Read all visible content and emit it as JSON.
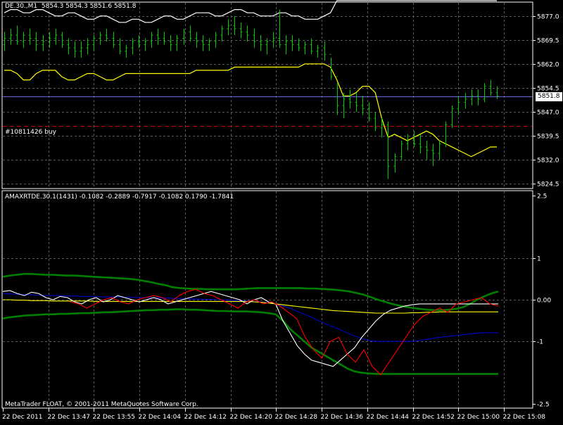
{
  "app": {
    "symbol_header": "DE.30.,M1",
    "ohlc_header": "5854.3 5854.3 5851.6 5851.8",
    "current_price_label": "5851.8",
    "order_label": "#10811426 buy",
    "indicator_header": "AMAXRTDE.30.1(1431) -0.1082 -0.2889 -0.7917 -0.1082 0.1790 -1.7841",
    "copyright": "MetaTrader FLOAT, © 2001-2011 MetaQuotes Software Corp.",
    "colors": {
      "background": "#000000",
      "grid": "#5a5a5a",
      "axis": "#ffffff",
      "bar": "#00cc00",
      "white_band": "#ffffff",
      "yellow_line": "#ffff00",
      "price_line": "#6b6bd6",
      "order_line": "#cc0000",
      "indicator_green": "#008000",
      "indicator_blue": "#0000cc",
      "indicator_red": "#ff0000",
      "indicator_white": "#ffffff",
      "indicator_yellow": "#ffff00"
    }
  },
  "chart_data": [
    {
      "type": "line",
      "panel": "price",
      "ylim": [
        5823,
        5882
      ],
      "yticks": [
        "5877.0",
        "5869.5",
        "5862.0",
        "5854.5",
        "5847.0",
        "5839.5",
        "5832.0",
        "5824.5"
      ],
      "x_labels": [
        "22 Dec 2011",
        "22 Dec 13:47",
        "22 Dec 13:55",
        "22 Dec 14:04",
        "22 Dec 14:12",
        "22 Dec 14:20",
        "22 Dec 14:28",
        "22 Dec 14:36",
        "22 Dec 14:44",
        "22 Dec 14:52",
        "22 Dec 15:00",
        "22 Dec 15:08"
      ],
      "current_price": 5851.8,
      "order_price": 5842.6,
      "bars": [
        [
          5868,
          5872,
          5866,
          5870
        ],
        [
          5870,
          5873,
          5868,
          5871
        ],
        [
          5871,
          5874,
          5868,
          5869
        ],
        [
          5869,
          5872,
          5867,
          5871
        ],
        [
          5871,
          5873,
          5868,
          5870
        ],
        [
          5870,
          5872,
          5866,
          5868
        ],
        [
          5868,
          5871,
          5866,
          5869
        ],
        [
          5869,
          5872,
          5867,
          5870
        ],
        [
          5870,
          5873,
          5868,
          5871
        ],
        [
          5871,
          5872,
          5867,
          5868
        ],
        [
          5868,
          5870,
          5865,
          5867
        ],
        [
          5867,
          5869,
          5864,
          5866
        ],
        [
          5866,
          5869,
          5864,
          5867
        ],
        [
          5867,
          5870,
          5865,
          5868
        ],
        [
          5868,
          5871,
          5866,
          5870
        ],
        [
          5870,
          5872,
          5868,
          5871
        ],
        [
          5871,
          5873,
          5869,
          5870
        ],
        [
          5870,
          5872,
          5867,
          5868
        ],
        [
          5868,
          5870,
          5865,
          5866
        ],
        [
          5866,
          5868,
          5864,
          5867
        ],
        [
          5867,
          5870,
          5865,
          5869
        ],
        [
          5869,
          5871,
          5867,
          5868
        ],
        [
          5868,
          5870,
          5866,
          5869
        ],
        [
          5869,
          5872,
          5867,
          5871
        ],
        [
          5871,
          5873,
          5868,
          5870
        ],
        [
          5870,
          5872,
          5868,
          5869
        ],
        [
          5869,
          5871,
          5866,
          5868
        ],
        [
          5868,
          5871,
          5866,
          5870
        ],
        [
          5870,
          5873,
          5868,
          5872
        ],
        [
          5872,
          5874,
          5869,
          5870
        ],
        [
          5870,
          5872,
          5867,
          5869
        ],
        [
          5869,
          5871,
          5866,
          5868
        ],
        [
          5868,
          5870,
          5866,
          5869
        ],
        [
          5869,
          5872,
          5867,
          5871
        ],
        [
          5871,
          5874,
          5869,
          5873
        ],
        [
          5873,
          5876,
          5871,
          5874
        ],
        [
          5874,
          5877,
          5871,
          5873
        ],
        [
          5873,
          5875,
          5870,
          5872
        ],
        [
          5872,
          5874,
          5869,
          5871
        ],
        [
          5871,
          5873,
          5867,
          5869
        ],
        [
          5869,
          5871,
          5866,
          5868
        ],
        [
          5868,
          5870,
          5865,
          5869
        ],
        [
          5869,
          5872,
          5867,
          5870
        ],
        [
          5870,
          5879,
          5867,
          5868
        ],
        [
          5868,
          5871,
          5865,
          5869
        ],
        [
          5869,
          5871,
          5866,
          5868
        ],
        [
          5868,
          5870,
          5866,
          5867
        ],
        [
          5867,
          5869,
          5865,
          5868
        ],
        [
          5868,
          5870,
          5865,
          5866
        ],
        [
          5866,
          5868,
          5864,
          5867
        ],
        [
          5867,
          5869,
          5863,
          5865
        ],
        [
          5865,
          5864,
          5857,
          5858
        ],
        [
          5858,
          5856,
          5846,
          5849
        ],
        [
          5849,
          5853,
          5845,
          5851
        ],
        [
          5851,
          5854,
          5848,
          5850
        ],
        [
          5850,
          5853,
          5847,
          5849
        ],
        [
          5849,
          5852,
          5846,
          5848
        ],
        [
          5848,
          5850,
          5844,
          5845
        ],
        [
          5845,
          5847,
          5841,
          5842
        ],
        [
          5842,
          5845,
          5839,
          5843
        ],
        [
          5843,
          5844,
          5826,
          5830
        ],
        [
          5830,
          5834,
          5828,
          5833
        ],
        [
          5833,
          5838,
          5832,
          5837
        ],
        [
          5837,
          5840,
          5835,
          5838
        ],
        [
          5838,
          5841,
          5836,
          5837
        ],
        [
          5837,
          5840,
          5834,
          5836
        ],
        [
          5836,
          5838,
          5832,
          5835
        ],
        [
          5835,
          5837,
          5830,
          5834
        ],
        [
          5834,
          5838,
          5832,
          5837
        ],
        [
          5837,
          5844,
          5836,
          5843
        ],
        [
          5843,
          5849,
          5842,
          5848
        ],
        [
          5848,
          5852,
          5846,
          5850
        ],
        [
          5850,
          5853,
          5848,
          5851
        ],
        [
          5851,
          5854,
          5849,
          5852
        ],
        [
          5852,
          5854,
          5849,
          5851
        ],
        [
          5851,
          5856,
          5850,
          5855
        ],
        [
          5855,
          5857,
          5852,
          5853
        ],
        [
          5853,
          5855,
          5851,
          5852
        ]
      ],
      "series": [
        {
          "color": "#ffffff",
          "values": [
            5878,
            5879,
            5879,
            5878,
            5878,
            5879,
            5879,
            5878,
            5877,
            5877,
            5878,
            5878,
            5877,
            5876,
            5876,
            5877,
            5877,
            5876,
            5875,
            5875,
            5876,
            5876,
            5875,
            5875,
            5876,
            5877,
            5877,
            5876,
            5876,
            5877,
            5878,
            5878,
            5878,
            5877,
            5877,
            5878,
            5879,
            5879,
            5878,
            5878,
            5877,
            5877,
            5877,
            5878,
            5878,
            5877,
            5877,
            5876,
            5876,
            5876,
            5877,
            5878,
            5882,
            5883,
            5884,
            5885,
            5885,
            5885,
            5885,
            5885,
            5885,
            5885,
            5885,
            5885,
            5885,
            5885,
            5885,
            5885,
            5885,
            5885,
            5885,
            5885,
            5885,
            5885,
            5885,
            5885,
            5885,
            5885
          ]
        },
        {
          "color": "#ffff00",
          "values": [
            5860,
            5860,
            5859,
            5857,
            5857,
            5859,
            5860,
            5860,
            5860,
            5858,
            5857,
            5857,
            5858,
            5859,
            5859,
            5858,
            5857,
            5857,
            5858,
            5859,
            5859,
            5859,
            5859,
            5859,
            5859,
            5859,
            5859,
            5859,
            5859,
            5859,
            5860,
            5860,
            5860,
            5860,
            5860,
            5860,
            5861,
            5861,
            5861,
            5861,
            5861,
            5861,
            5861,
            5861,
            5861,
            5861,
            5861,
            5862,
            5862,
            5862,
            5862,
            5861,
            5857,
            5852,
            5852,
            5853,
            5855,
            5855,
            5853,
            5845,
            5839,
            5840,
            5839,
            5838,
            5839,
            5840,
            5841,
            5840,
            5838,
            5837,
            5836,
            5835,
            5834,
            5833,
            5834,
            5835,
            5836,
            5836
          ]
        }
      ]
    },
    {
      "type": "line",
      "panel": "indicator",
      "ylim": [
        -2.6,
        2.6
      ],
      "yticks": [
        "2.5",
        "1",
        "0.00",
        "-1",
        "-2.5"
      ],
      "series": [
        {
          "color": "#008000",
          "values": [
            0.55,
            0.58,
            0.6,
            0.62,
            0.62,
            0.61,
            0.6,
            0.6,
            0.59,
            0.58,
            0.58,
            0.57,
            0.56,
            0.55,
            0.54,
            0.53,
            0.52,
            0.51,
            0.5,
            0.48,
            0.45,
            0.42,
            0.38,
            0.35,
            0.3,
            0.28,
            0.27,
            0.26,
            0.26,
            0.25,
            0.25,
            0.25,
            0.25,
            0.25,
            0.26,
            0.27,
            0.28,
            0.28,
            0.28,
            0.28,
            0.28,
            0.28,
            0.28,
            0.27,
            0.27,
            0.26,
            0.25,
            0.24,
            0.22,
            0.2,
            0.16,
            0.12,
            0.06,
            0.0,
            -0.05,
            -0.1,
            -0.14,
            -0.17,
            -0.2,
            -0.22,
            -0.24,
            -0.25,
            -0.25,
            -0.24,
            -0.22,
            -0.18,
            -0.1,
            0.0,
            0.08,
            0.15,
            0.2
          ]
        },
        {
          "color": "#008000",
          "values": [
            -0.45,
            -0.42,
            -0.4,
            -0.38,
            -0.37,
            -0.36,
            -0.35,
            -0.35,
            -0.34,
            -0.34,
            -0.33,
            -0.32,
            -0.32,
            -0.31,
            -0.3,
            -0.3,
            -0.29,
            -0.28,
            -0.27,
            -0.26,
            -0.25,
            -0.25,
            -0.24,
            -0.24,
            -0.23,
            -0.23,
            -0.24,
            -0.24,
            -0.25,
            -0.26,
            -0.27,
            -0.27,
            -0.28,
            -0.28,
            -0.28,
            -0.29,
            -0.3,
            -0.32,
            -0.35,
            -0.5,
            -0.7,
            -0.85,
            -1.0,
            -1.15,
            -1.25,
            -1.35,
            -1.45,
            -1.55,
            -1.65,
            -1.72,
            -1.75,
            -1.77,
            -1.78,
            -1.78,
            -1.78,
            -1.78,
            -1.78,
            -1.78,
            -1.78,
            -1.78,
            -1.78,
            -1.78,
            -1.78,
            -1.78,
            -1.78,
            -1.78,
            -1.78,
            -1.78,
            -1.78,
            -1.78
          ]
        },
        {
          "color": "#0000cc",
          "values": [
            0.15,
            0.14,
            0.13,
            0.12,
            0.12,
            0.11,
            0.1,
            0.1,
            0.1,
            0.09,
            0.09,
            0.08,
            0.08,
            0.08,
            0.07,
            0.07,
            0.07,
            0.06,
            0.06,
            0.05,
            0.05,
            0.05,
            0.04,
            0.04,
            0.03,
            0.03,
            0.02,
            0.02,
            0.01,
            0.01,
            0.0,
            0.0,
            -0.01,
            -0.02,
            -0.03,
            -0.04,
            -0.05,
            -0.07,
            -0.1,
            -0.15,
            -0.2,
            -0.28,
            -0.35,
            -0.42,
            -0.5,
            -0.58,
            -0.65,
            -0.72,
            -0.8,
            -0.87,
            -0.93,
            -0.98,
            -1.0,
            -1.0,
            -1.0,
            -1.0,
            -1.0,
            -1.0,
            -0.98,
            -0.95,
            -0.92,
            -0.9,
            -0.88,
            -0.86,
            -0.84,
            -0.82,
            -0.8,
            -0.79,
            -0.79,
            -0.79
          ]
        },
        {
          "color": "#ffff00",
          "values": [
            0.0,
            0.0,
            -0.01,
            -0.01,
            -0.02,
            -0.02,
            -0.02,
            -0.03,
            -0.03,
            -0.03,
            -0.03,
            -0.03,
            -0.03,
            -0.04,
            -0.04,
            -0.04,
            -0.04,
            -0.04,
            -0.04,
            -0.04,
            -0.04,
            -0.04,
            -0.04,
            -0.04,
            -0.04,
            -0.04,
            -0.04,
            -0.04,
            -0.04,
            -0.04,
            -0.04,
            -0.04,
            -0.04,
            -0.04,
            -0.04,
            -0.05,
            -0.06,
            -0.08,
            -0.1,
            -0.12,
            -0.14,
            -0.16,
            -0.18,
            -0.2,
            -0.22,
            -0.24,
            -0.26,
            -0.27,
            -0.28,
            -0.29,
            -0.3,
            -0.31,
            -0.32,
            -0.32,
            -0.32,
            -0.32,
            -0.32,
            -0.31,
            -0.31,
            -0.3,
            -0.3,
            -0.29,
            -0.29,
            -0.29,
            -0.29,
            -0.29,
            -0.29,
            -0.29,
            -0.29,
            -0.29
          ]
        },
        {
          "color": "#ffffff",
          "values": [
            0.2,
            0.22,
            0.15,
            0.1,
            0.18,
            0.15,
            0.05,
            0.0,
            0.08,
            0.05,
            -0.05,
            -0.1,
            0.0,
            0.05,
            -0.05,
            0.0,
            0.1,
            0.05,
            0.0,
            -0.05,
            0.0,
            0.05,
            0.0,
            -0.1,
            -0.05,
            0.0,
            0.05,
            0.1,
            0.15,
            0.2,
            0.15,
            0.1,
            0.05,
            0.0,
            -0.1,
            0.0,
            0.05,
            -0.05,
            -0.1,
            -0.5,
            -0.8,
            -1.1,
            -1.3,
            -1.45,
            -1.5,
            -1.55,
            -1.6,
            -1.45,
            -1.3,
            -1.15,
            -0.9,
            -0.7,
            -0.5,
            -0.35,
            -0.25,
            -0.2,
            -0.15,
            -0.12,
            -0.1,
            -0.1,
            -0.1,
            -0.1,
            -0.1,
            -0.1,
            -0.1,
            -0.1,
            -0.1,
            -0.1,
            -0.1,
            -0.1
          ]
        },
        {
          "color": "#ff0000",
          "values": [
            null,
            null,
            null,
            null,
            null,
            null,
            null,
            null,
            -0.05,
            -0.1,
            -0.2,
            -0.1,
            0.0,
            0.05,
            -0.05,
            -0.1,
            0.0,
            0.05,
            0.1,
            0.05,
            -0.05,
            0.1,
            0.2,
            0.25,
            0.15,
            0.1,
            0.0,
            -0.1,
            -0.2,
            -0.05,
            0.0,
            -0.1,
            -0.05,
            -0.15,
            -0.3,
            -0.45,
            -0.9,
            -1.2,
            -1.4,
            -1.0,
            -0.9,
            -1.3,
            -1.5,
            -1.2,
            -1.6,
            -1.8,
            -1.5,
            -1.2,
            -0.9,
            -0.6,
            -0.4,
            -0.3,
            -0.2,
            -0.3,
            -0.1,
            -0.05,
            0.0,
            0.05,
            -0.1,
            -0.15
          ]
        }
      ]
    }
  ]
}
